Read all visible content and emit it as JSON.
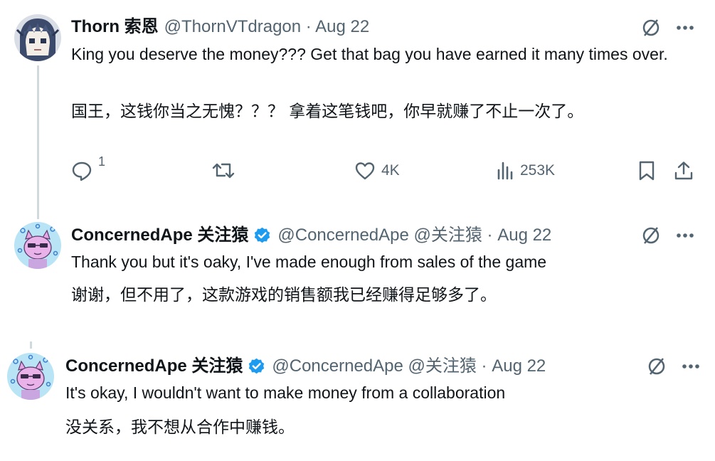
{
  "tweets": [
    {
      "name": "Thorn 索恩",
      "handle": "@ThornVTdragon · Aug 22",
      "text": "King you deserve the money??? Get that bag you have earned it many times over.",
      "translation": "国王，这钱你当之无愧？？？ 拿着这笔钱吧，你早就赚了不止一次了。",
      "actions": {
        "replies": "1",
        "likes": "4K",
        "views": "253K"
      }
    },
    {
      "name": "ConcernedApe 关注猿",
      "handle": "@ConcernedApe @关注猿 · Aug 22",
      "text": "Thank you but it's oaky, I've made enough from sales of the game",
      "translation": "谢谢，但不用了，这款游戏的销售额我已经赚得足够多了。"
    },
    {
      "name": "ConcernedApe 关注猿",
      "handle": "@ConcernedApe @关注猿 · Aug 22",
      "text": "It's okay, I wouldn't want to make money from a collaboration",
      "translation": "没关系，我不想从合作中赚钱。"
    }
  ],
  "colors": {
    "text": "#0f1419",
    "secondary": "#536471",
    "verified": "#1d9bf0",
    "thread_line": "#cfd9de"
  }
}
